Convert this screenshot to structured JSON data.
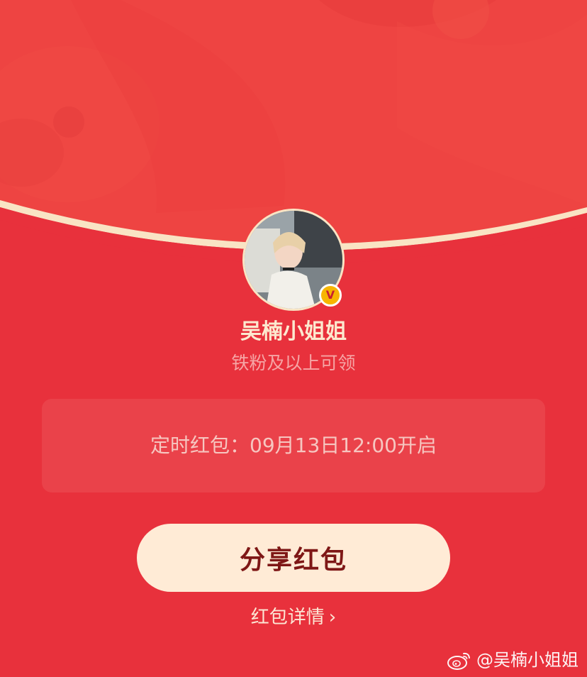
{
  "profile": {
    "name": "吴楠小姐姐",
    "verified_mark": "V",
    "eligibility": "铁粉及以上可领"
  },
  "packet": {
    "schedule_text": "定时红包：09月13日12:00开启"
  },
  "actions": {
    "share_label": "分享红包",
    "details_label": "红包详情",
    "details_chevron": "›"
  },
  "watermark": {
    "text": "@吴楠小姐姐",
    "icon": "weibo-logo-icon"
  },
  "colors": {
    "background": "#E8313C",
    "top_panel": "#EE4442",
    "arc": "#F9E4C4",
    "button_bg": "#FFEBD6",
    "button_text": "#7E1716",
    "badge": "#F7B500"
  }
}
